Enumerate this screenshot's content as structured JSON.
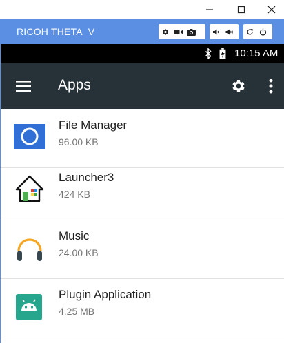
{
  "window": {
    "app_name": "RICOH THETA_V"
  },
  "status_bar": {
    "time": "10:15 AM"
  },
  "app_bar": {
    "title": "Apps"
  },
  "apps": [
    {
      "name": "File Manager",
      "size": "96.00 KB",
      "icon": "file-manager-icon"
    },
    {
      "name": "Launcher3",
      "size": "424 KB",
      "icon": "launcher-house-icon"
    },
    {
      "name": "Music",
      "size": "24.00 KB",
      "icon": "headphones-icon"
    },
    {
      "name": "Plugin Application",
      "size": "4.25 MB",
      "icon": "android-robot-icon"
    }
  ],
  "colors": {
    "toolbar": "#5b8fe3",
    "status_bar": "#000000",
    "app_bar": "#263238",
    "file_manager_blue": "#2f6fd6",
    "plugin_green": "#27a68e",
    "music_orange": "#f5a623"
  }
}
